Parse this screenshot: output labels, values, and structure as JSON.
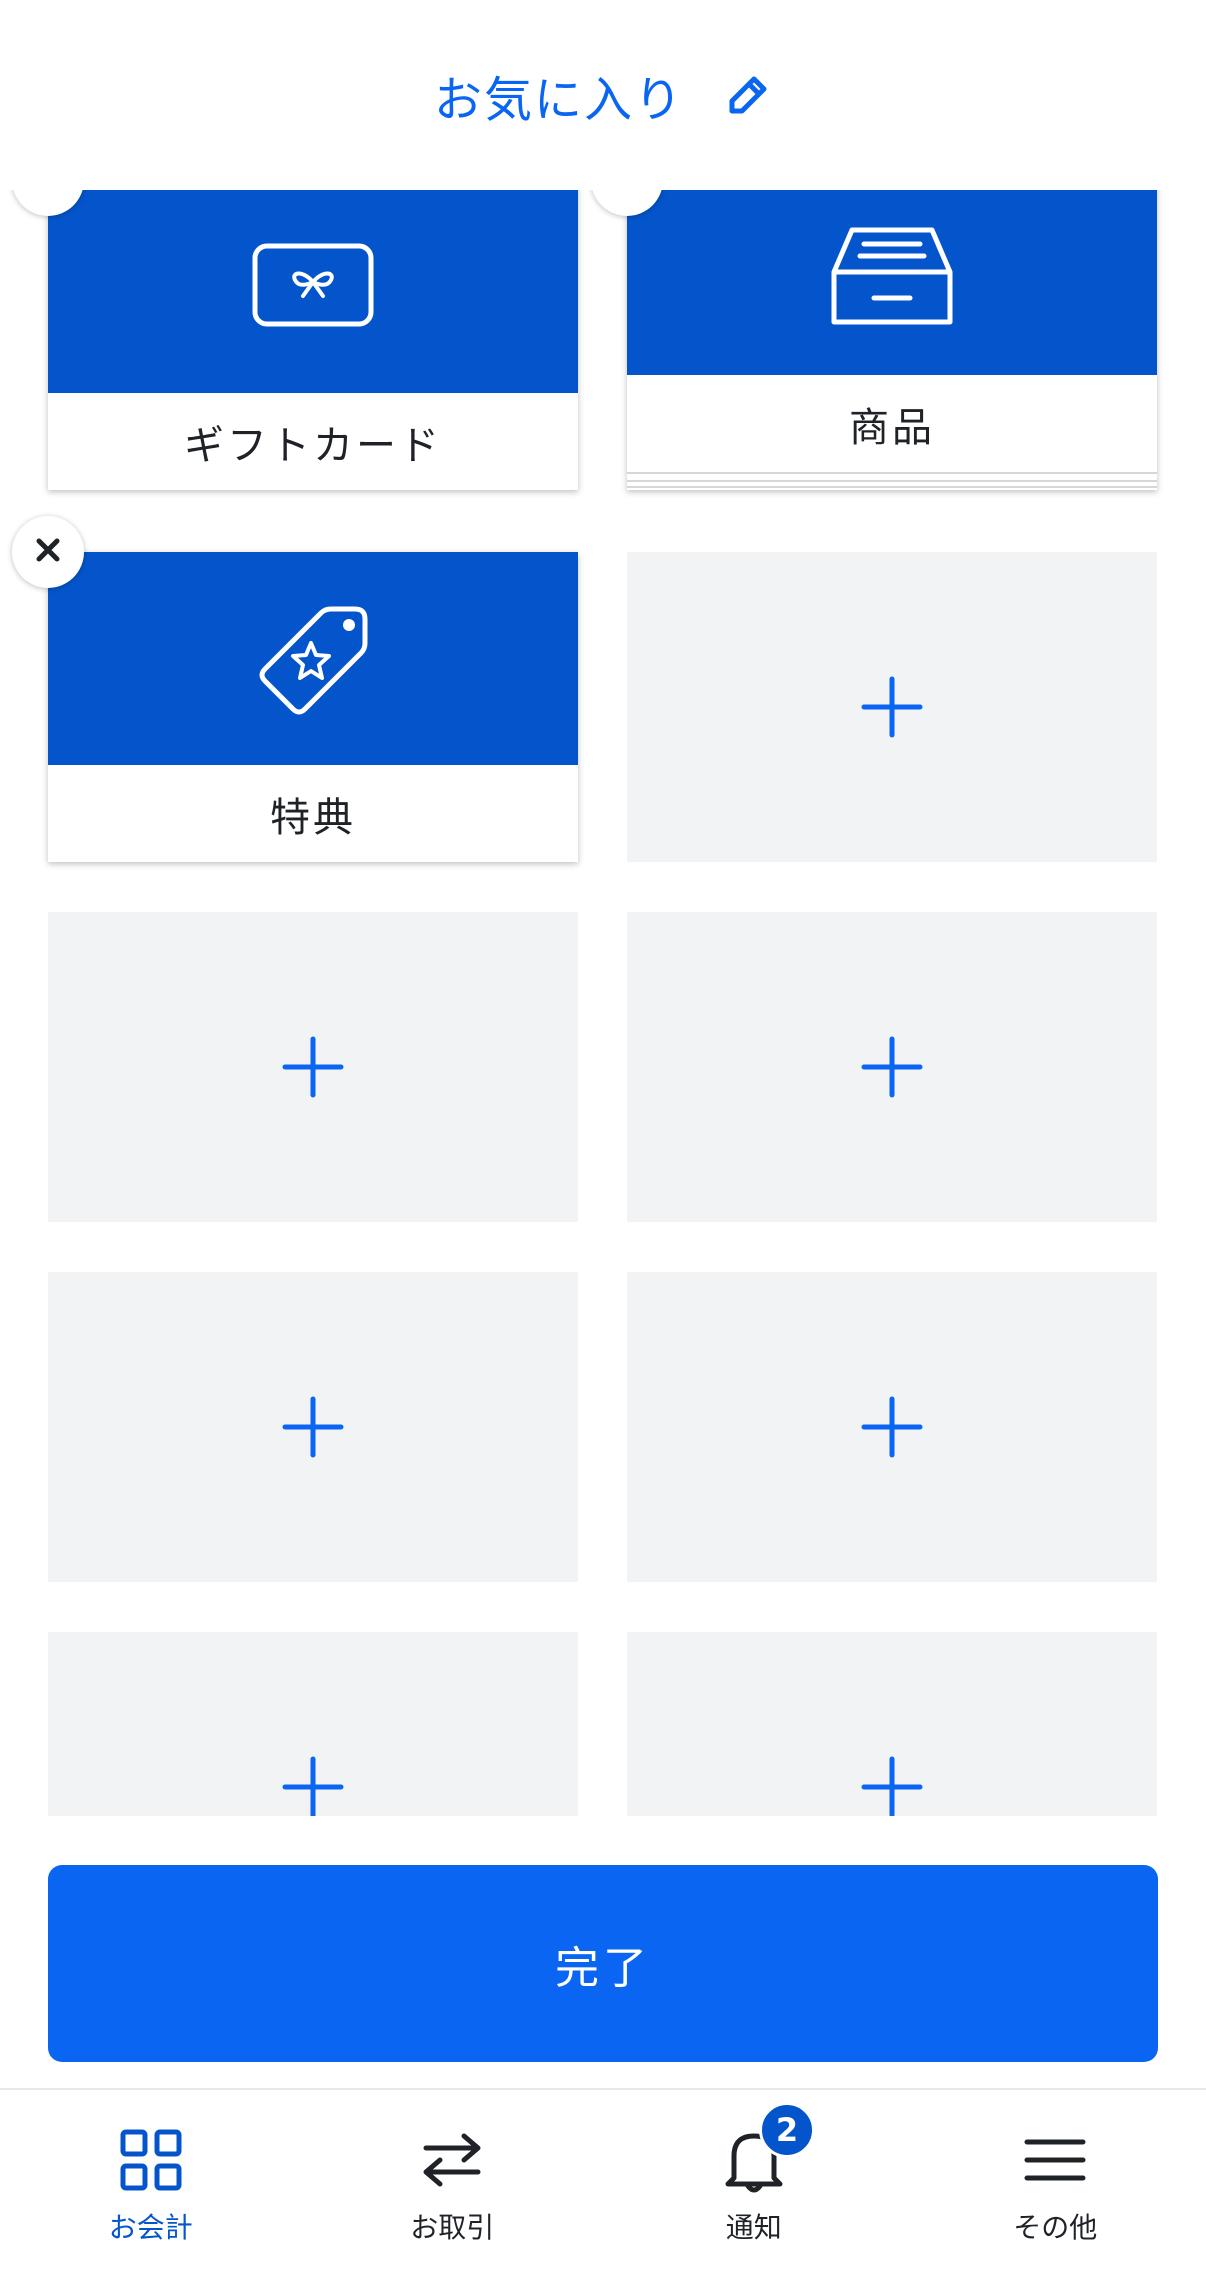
{
  "header": {
    "title": "お気に入り"
  },
  "tiles": [
    {
      "type": "filled",
      "label": "ギフトカード",
      "icon": "gift-card-icon",
      "badge": "chevron-up-icon"
    },
    {
      "type": "filled",
      "label": "商品",
      "icon": "inventory-tray-icon",
      "badge": "chevron-up-icon"
    },
    {
      "type": "filled",
      "label": "特典",
      "icon": "reward-tag-icon",
      "badge": "close-icon"
    },
    {
      "type": "empty"
    },
    {
      "type": "empty"
    },
    {
      "type": "empty"
    },
    {
      "type": "empty"
    },
    {
      "type": "empty"
    },
    {
      "type": "empty"
    },
    {
      "type": "empty"
    }
  ],
  "done_button": {
    "label": "完了"
  },
  "bottom_nav": {
    "items": [
      {
        "label": "お会計",
        "icon": "grid-icon",
        "active": true
      },
      {
        "label": "お取引",
        "icon": "transfer-arrows-icon",
        "active": false
      },
      {
        "label": "通知",
        "icon": "bell-icon",
        "active": false,
        "badge": "2"
      },
      {
        "label": "その他",
        "icon": "menu-icon",
        "active": false
      }
    ]
  },
  "colors": {
    "accent": "#0a66f2",
    "tile_blue": "#0455cc",
    "empty_tile": "#f2f3f5"
  }
}
